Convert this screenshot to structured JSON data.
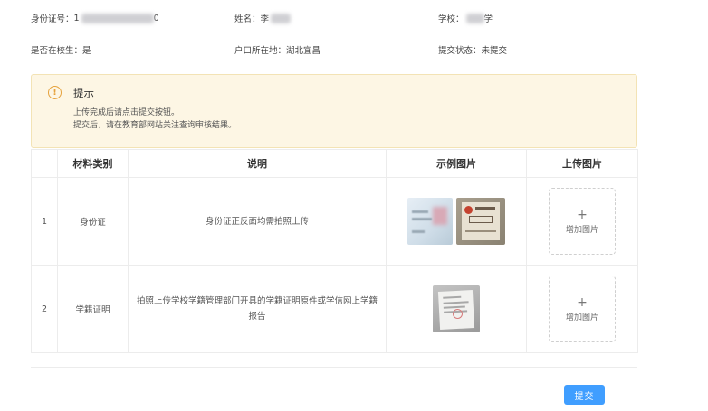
{
  "info": {
    "id_number": {
      "label": "身份证号：",
      "value": "1",
      "value_tail": "0"
    },
    "name": {
      "label": "姓名：",
      "value": "李"
    },
    "school": {
      "label": "学校：",
      "value": "学"
    },
    "is_student": {
      "label": "是否在校生：",
      "value": "是"
    },
    "hukou": {
      "label": "户口所在地：",
      "value": "湖北宜昌"
    },
    "submit_status": {
      "label": "提交状态：",
      "value": "未提交"
    }
  },
  "notice": {
    "icon": "warning-icon",
    "icon_glyph": "!",
    "title": "提示",
    "lines": [
      "上传完成后请点击提交按钮。",
      "提交后，请在教育部网站关注查询审核结果。"
    ]
  },
  "table": {
    "headers": [
      "",
      "材料类别",
      "说明",
      "示例图片",
      "上传图片"
    ],
    "rows": [
      {
        "index": "1",
        "category": "身份证",
        "description": "身份证正反面均需拍照上传",
        "upload_label": "增加图片",
        "upload_plus": "+"
      },
      {
        "index": "2",
        "category": "学籍证明",
        "description": "拍照上传学校学籍管理部门开具的学籍证明原件或学信网上学籍报告",
        "upload_label": "增加图片",
        "upload_plus": "+"
      }
    ]
  },
  "submit_label": "提交",
  "colors": {
    "primary": "#409eff",
    "warning": "#e6a23c",
    "notice_bg": "#fdf6e4"
  }
}
